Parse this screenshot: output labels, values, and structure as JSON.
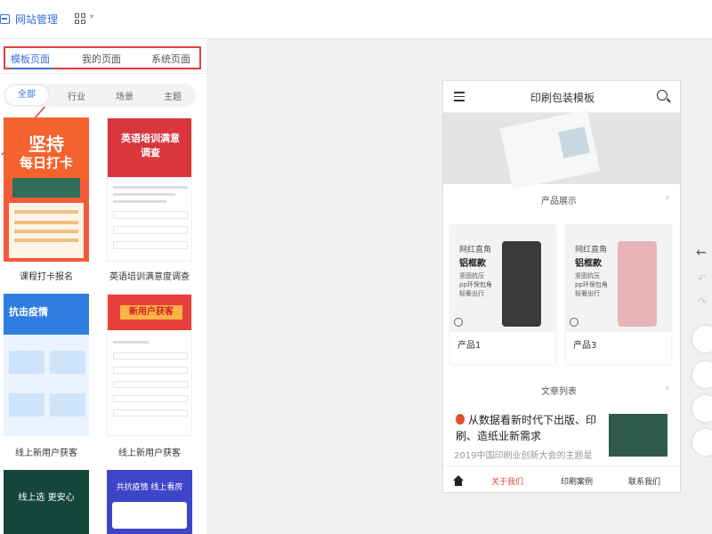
{
  "header": {
    "site_label": "网站管理"
  },
  "left_panel": {
    "tabs": [
      "模板页面",
      "我的页面",
      "系统页面"
    ],
    "filters": [
      "全部",
      "行业",
      "场景",
      "主题"
    ],
    "templates": [
      {
        "label": "课程打卡报名",
        "poster_line1": "坚持",
        "poster_line2": "每日打卡"
      },
      {
        "label": "英语培训满意度调查",
        "poster_line1": "英语培训满意",
        "poster_line2": "调查"
      },
      {
        "label": "线上新用户获客",
        "poster_line1": "抗击疫情"
      },
      {
        "label": "线上新用户获客",
        "poster_line1": "新用户获客"
      },
      {
        "label": "",
        "poster_line1": "线上选 更安心"
      },
      {
        "label": "",
        "poster_line1": "共抗疫情 线上看房"
      }
    ]
  },
  "preview": {
    "title": "印刷包装模板",
    "section_products": "产品展示",
    "section_articles": "文章列表",
    "products": [
      {
        "name": "产品1",
        "tag1": "网红直角",
        "tag2": "铝框款",
        "features": [
          "坚固抗压",
          "pp环保包角",
          "轻奢出行"
        ],
        "color": "#3a3a3a"
      },
      {
        "name": "产品3",
        "tag1": "网红直角",
        "tag2": "铝框款",
        "features": [
          "坚固抗压",
          "pp环保包角",
          "轻奢出行"
        ],
        "color": "#e8b4b8"
      }
    ],
    "article": {
      "title": "从数据看新时代下出版、印刷、造纸业新需求",
      "subtitle": "2019中国印刷业创新大会的主题是"
    },
    "footer": [
      "关于我们",
      "印刷案例",
      "联系我们"
    ]
  },
  "colors": {
    "accent": "#3b6fd6",
    "highlight": "#e04040"
  }
}
